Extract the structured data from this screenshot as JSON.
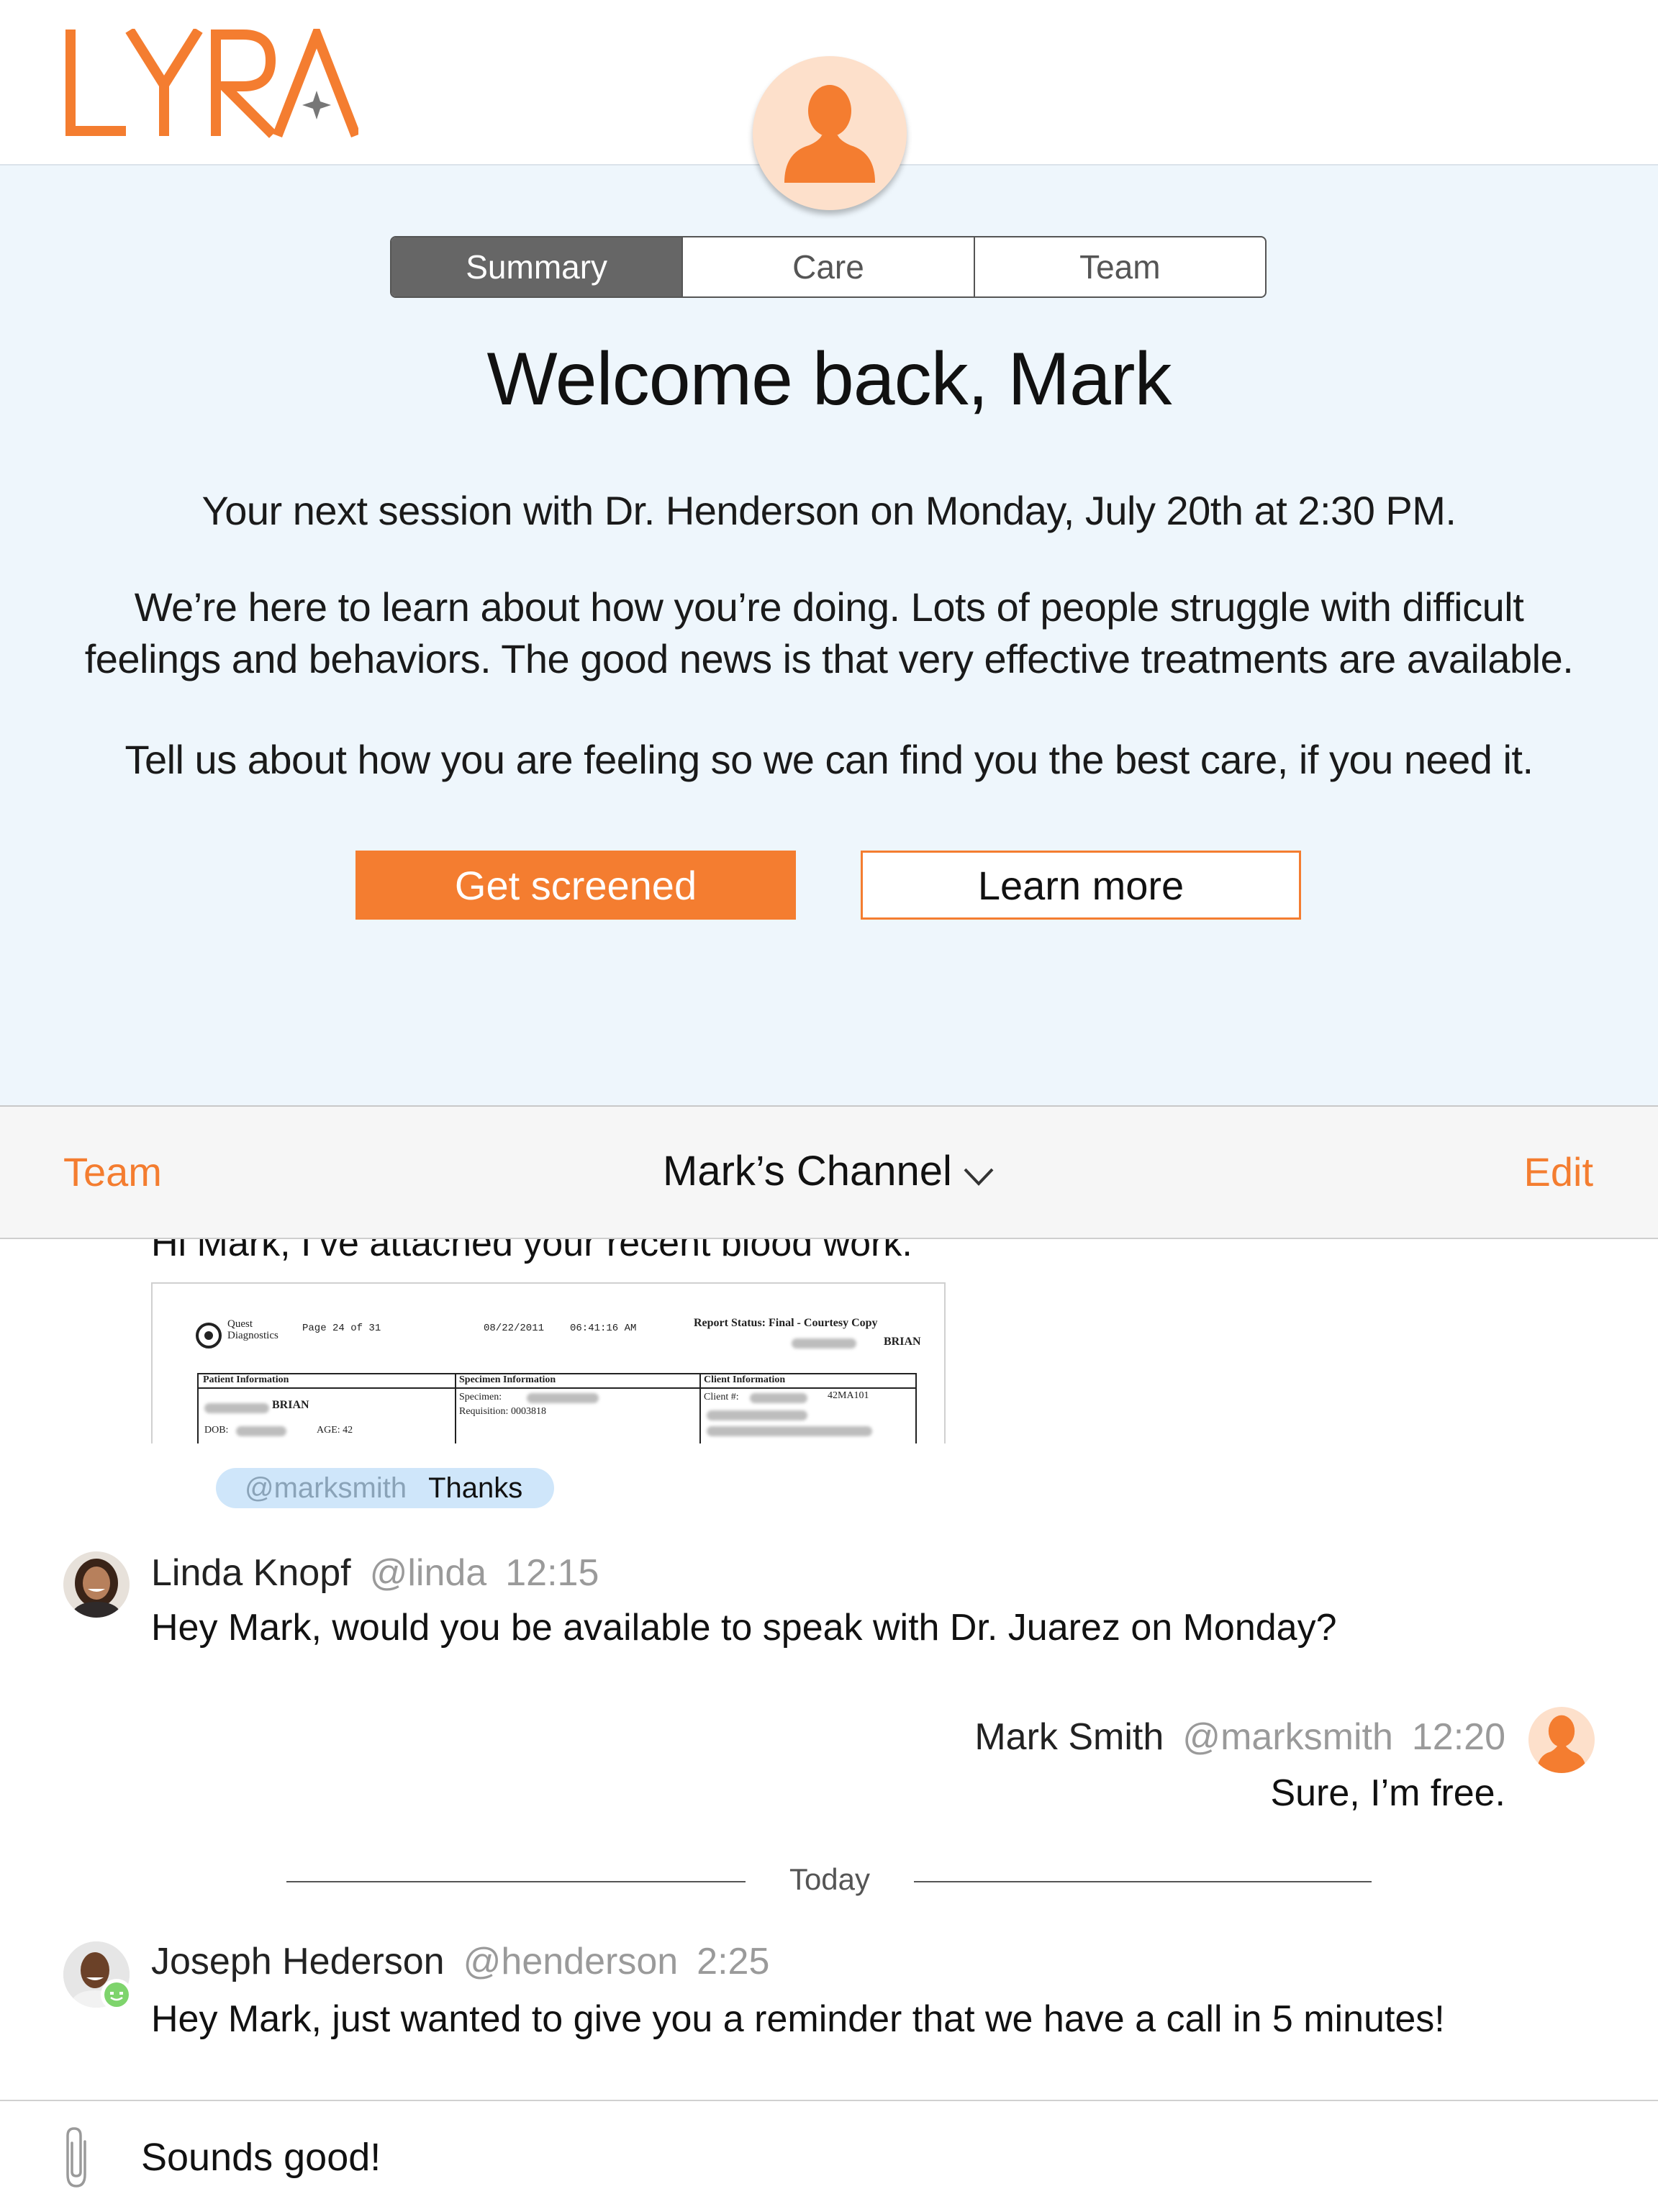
{
  "brand": {
    "logo_text": "LYRA",
    "accent_color": "#f47d30"
  },
  "header": {
    "avatar_icon": "user-silhouette-icon"
  },
  "tabs": [
    {
      "label": "Summary",
      "active": true
    },
    {
      "label": "Care",
      "active": false
    },
    {
      "label": "Team",
      "active": false
    }
  ],
  "summary": {
    "welcome": "Welcome back, Mark",
    "session_text": "Your next session with Dr. Henderson on Monday, July 20th at 2:30 PM.",
    "intro_line1": "We’re here to learn about how you’re doing. Lots of people struggle with difficult",
    "intro_line2": "feelings and behaviors. The good news is that very effective treatments are available.",
    "prompt_text": "Tell us about how you are feeling so we can find you the best care, if you need it.",
    "primary_button": "Get screened",
    "secondary_button": "Learn more"
  },
  "channel": {
    "left_action": "Team",
    "title": "Mark’s Channel",
    "right_action": "Edit"
  },
  "messages": {
    "partial": {
      "text": "Hi Mark, I’ve attached your recent blood work.",
      "attachment": {
        "brand": "Quest",
        "brand2": "Diagnostics",
        "page": "Page  24  of  31",
        "date": "08/22/2011",
        "time": "06:41:16  AM",
        "status": "Report Status: Final - Courtesy Copy",
        "name": "BRIAN",
        "col1": "Patient Information",
        "col2": "Specimen Information",
        "col3": "Client Information",
        "patient_name": "BRIAN",
        "dob": "DOB:",
        "age": "AGE: 42",
        "specimen": "Specimen:",
        "requisition": "Requisition:  0003818",
        "client": "Client #:",
        "client_code": "42MA101"
      },
      "reply": {
        "mention": "@marksmith",
        "text": "Thanks"
      }
    },
    "linda": {
      "name": "Linda Knopf",
      "handle": "@linda",
      "time": "12:15",
      "text": "Hey Mark, would you be available to speak with Dr. Juarez on Monday?"
    },
    "mark": {
      "name": "Mark Smith",
      "handle": "@marksmith",
      "time": "12:20",
      "text": "Sure, I’m free."
    },
    "divider": "Today",
    "joseph": {
      "name": "Joseph Hederson",
      "handle": "@henderson",
      "time": "2:25",
      "text": "Hey Mark, just wanted to give you a reminder that we have a call in 5 minutes!"
    }
  },
  "composer": {
    "value": "Sounds good!",
    "attach_icon": "paperclip-icon"
  }
}
